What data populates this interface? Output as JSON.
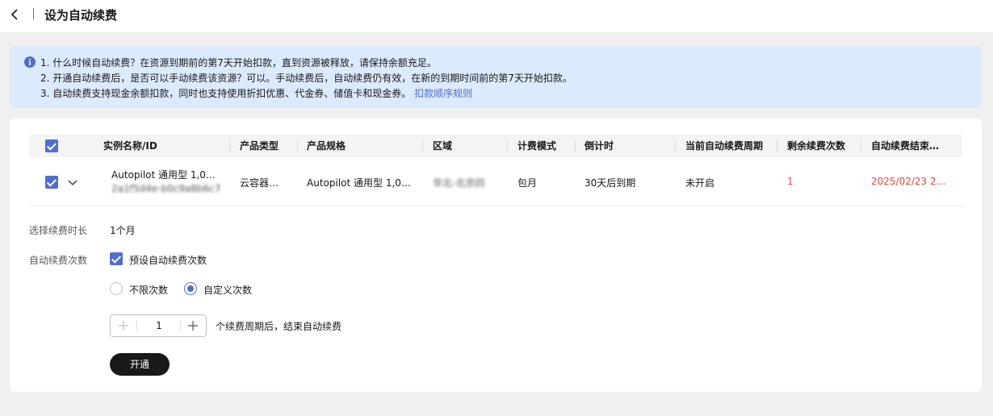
{
  "header": {
    "title": "设为自动续费",
    "back_icon": "chevron-left-icon"
  },
  "notice": {
    "icon": "info-icon",
    "line1": "1. 什么时候自动续费？在资源到期前的第7天开始扣款，直到资源被释放，请保持余额充足。",
    "line2": "2. 开通自动续费后，是否可以手动续费该资源？可以。手动续费后，自动续费仍有效，在新的到期时间前的第7天开始扣款。",
    "line3_text": "3. 自动续费支持现金余额扣款，同时也支持使用折扣优惠、代金券、储值卡和现金券。",
    "line3_link": "扣款顺序规则"
  },
  "table": {
    "headers": [
      "实例名称/ID",
      "产品类型",
      "产品规格",
      "区域",
      "计费模式",
      "倒计时",
      "当前自动续费周期",
      "剩余续费次数",
      "自动续费结束…"
    ],
    "row": {
      "name": "Autopilot 通用型 1,000…",
      "id": "2a1f5d4e-b0c9a8b6c7f",
      "product_type": "云容器…",
      "spec": "Autopilot 通用型 1,000…",
      "region": "华北-北京四",
      "billing": "包月",
      "countdown": "30天后到期",
      "period": "未开启",
      "remaining": "1",
      "end_time": "2025/02/23 23:…"
    }
  },
  "form": {
    "duration_label": "选择续费时长",
    "duration_value": "1个月",
    "times_label": "自动续费次数",
    "preset_checkbox_label": "预设自动续费次数",
    "radio_unlimited": "不限次数",
    "radio_custom": "自定义次数",
    "stepper_value": "1",
    "stepper_suffix": "个续费周期后，结束自动续费",
    "submit": "开通"
  },
  "colors": {
    "accent": "#526ecc",
    "danger": "#e54545",
    "notice_bg": "#dbeafc"
  }
}
